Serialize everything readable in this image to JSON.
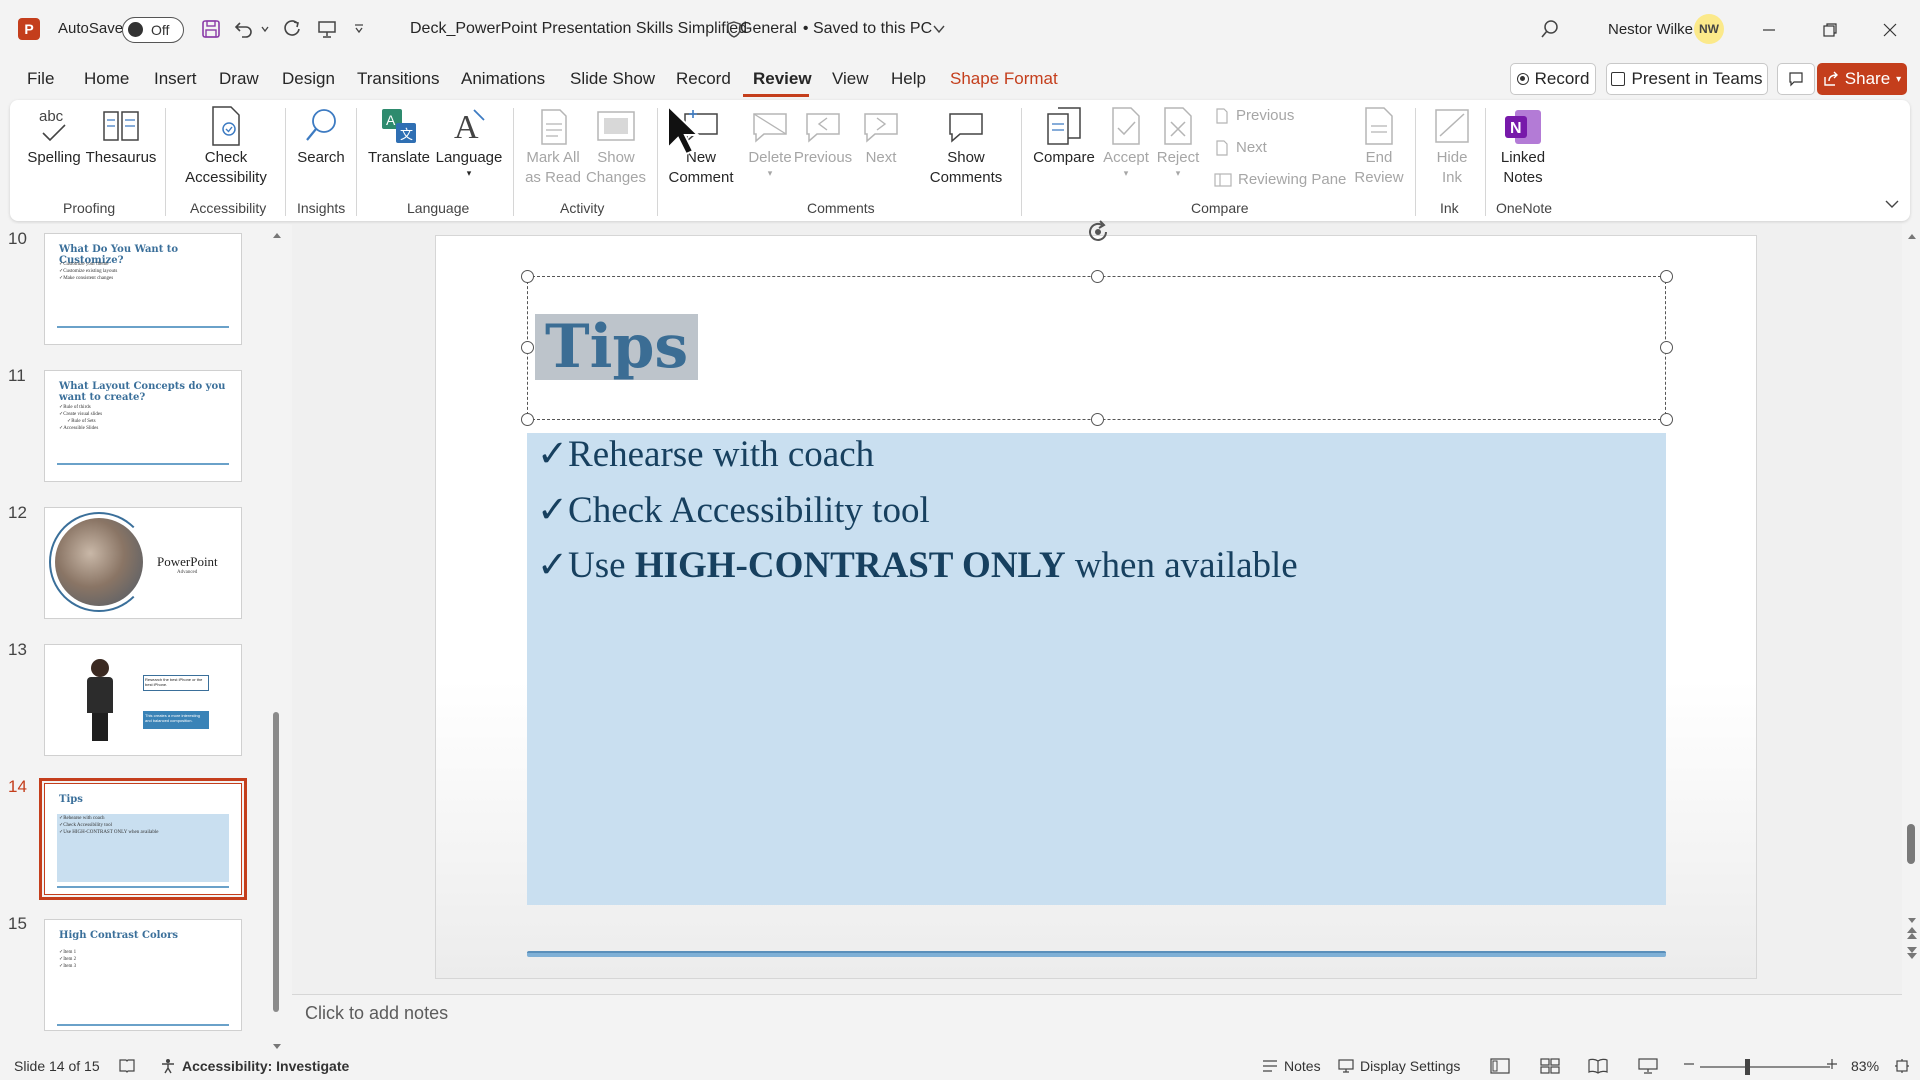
{
  "titlebar": {
    "app_icon": "P",
    "autosave_label": "AutoSave",
    "autosave_state": "Off",
    "doc_title": "Deck_PowerPoint Presentation Skills Simplified",
    "sensitivity": "General",
    "save_status": "• Saved to this PC",
    "user_name": "Nestor Wilke",
    "user_initials": "NW"
  },
  "menu": {
    "tabs": [
      "File",
      "Home",
      "Insert",
      "Draw",
      "Design",
      "Transitions",
      "Animations",
      "Slide Show",
      "Record",
      "Review",
      "View",
      "Help",
      "Shape Format"
    ],
    "active_tab": "Review",
    "record_button": "Record",
    "present_teams_button": "Present in Teams",
    "share_button": "Share"
  },
  "ribbon": {
    "proofing": {
      "spelling": "Spelling",
      "thesaurus": "Thesaurus",
      "group": "Proofing"
    },
    "accessibility": {
      "check_line1": "Check",
      "check_line2": "Accessibility",
      "group": "Accessibility"
    },
    "insights": {
      "search": "Search",
      "group": "Insights"
    },
    "language": {
      "translate": "Translate",
      "language": "Language",
      "group": "Language"
    },
    "activity": {
      "mark_all_line1": "Mark All",
      "mark_all_line2": "as Read",
      "show_changes_line1": "Show",
      "show_changes_line2": "Changes",
      "group": "Activity"
    },
    "comments": {
      "new_line1": "New",
      "new_line2": "Comment",
      "delete": "Delete",
      "previous": "Previous",
      "next": "Next",
      "show_line1": "Show",
      "show_line2": "Comments",
      "group": "Comments"
    },
    "compare": {
      "compare": "Compare",
      "accept": "Accept",
      "reject": "Reject",
      "previous": "Previous",
      "next": "Next",
      "reviewing_pane": "Reviewing Pane",
      "end_line1": "End",
      "end_line2": "Review",
      "group": "Compare"
    },
    "ink": {
      "hide_line1": "Hide",
      "hide_line2": "Ink",
      "group": "Ink"
    },
    "onenote": {
      "linked_line1": "Linked",
      "linked_line2": "Notes",
      "group": "OneNote"
    }
  },
  "slides": [
    {
      "number": "10",
      "title": "What Do You Want to Customize?",
      "bullets": [
        "✓Customize your theme",
        "✓Customize existing layouts",
        "✓Make consistent changes"
      ]
    },
    {
      "number": "11",
      "title": "What Layout Concepts do you want to create?",
      "bullets": [
        "✓Rule of thirds",
        "✓Create visual slides",
        "   ✓Rule of Sets",
        "✓Accessible Slides"
      ]
    },
    {
      "number": "12",
      "title": "PowerPoint",
      "subtitle": "Advanced"
    },
    {
      "number": "13",
      "callout1": "Research the best iPhone or the best iPhone.",
      "callout2": "This creates a more interesting and balanced composition."
    },
    {
      "number": "14",
      "title": "Tips",
      "bullets": [
        "✓Rehearse with coach",
        "✓Check Accessibility tool",
        "✓Use HIGH-CONTRAST ONLY when available"
      ]
    },
    {
      "number": "15",
      "title": "High Contrast Colors",
      "bullets": [
        "✓Item 1",
        "✓Item 2",
        "✓Item 3"
      ]
    }
  ],
  "active_slide": "14",
  "slide": {
    "title": "Tips",
    "bullet_check": "✓",
    "bullet1": "Rehearse with coach",
    "bullet2": "Check Accessibility tool",
    "bullet3_pre": "Use ",
    "bullet3_bold": "HIGH-CONTRAST ONLY",
    "bullet3_post": " when available"
  },
  "notes_placeholder": "Click to add notes",
  "status": {
    "slide_counter": "Slide 14 of 15",
    "accessibility": "Accessibility: Investigate",
    "notes": "Notes",
    "display_settings": "Display Settings",
    "zoom": "83%"
  },
  "colors": {
    "accent": "#c43e1c",
    "title_blue": "#3b6d94",
    "content_fill": "#c9dff0"
  }
}
